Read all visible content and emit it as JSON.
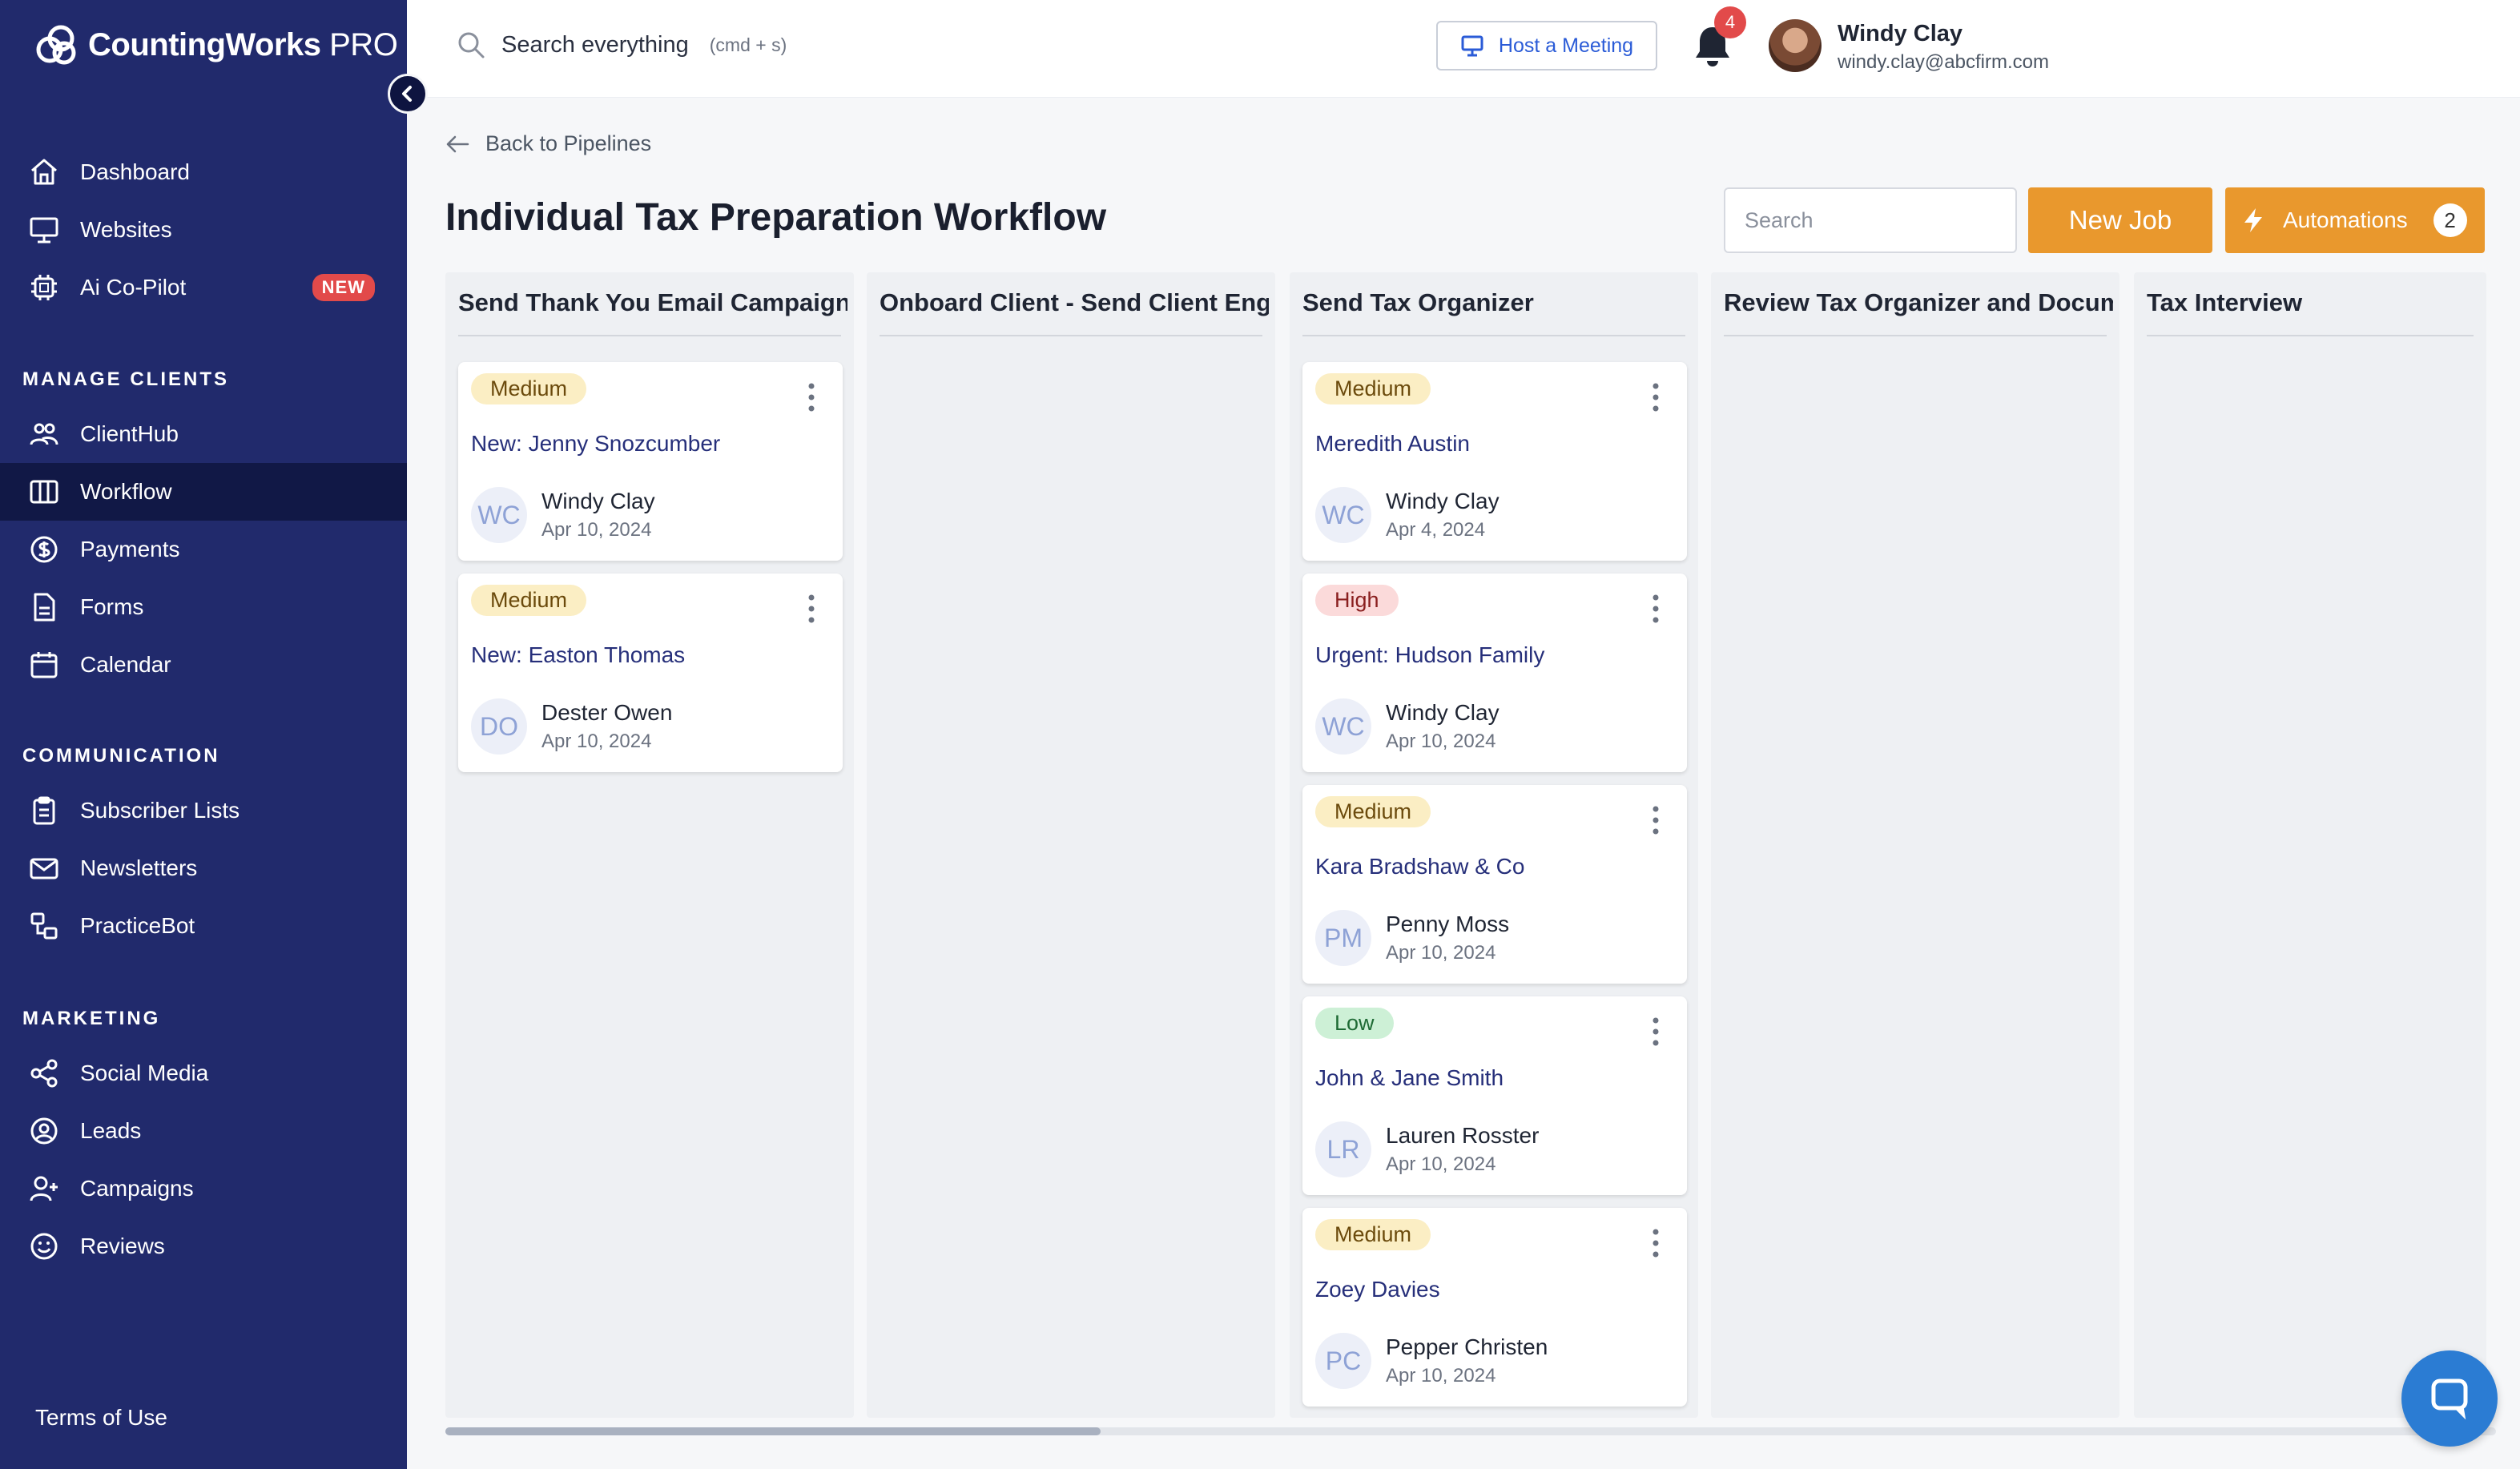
{
  "app": {
    "logo_main": "CountingWorks",
    "logo_pro": " PRO"
  },
  "sidebar": {
    "items_top": [
      {
        "label": "Dashboard",
        "icon": "home-icon"
      },
      {
        "label": "Websites",
        "icon": "monitor-icon"
      },
      {
        "label": "Ai Co-Pilot",
        "icon": "chip-icon",
        "badge": "NEW"
      }
    ],
    "section_manage": "MANAGE CLIENTS",
    "items_manage": [
      {
        "label": "ClientHub",
        "icon": "users-icon"
      },
      {
        "label": "Workflow",
        "icon": "columns-icon",
        "active": true
      },
      {
        "label": "Payments",
        "icon": "dollar-icon"
      },
      {
        "label": "Forms",
        "icon": "document-icon"
      },
      {
        "label": "Calendar",
        "icon": "calendar-icon"
      }
    ],
    "section_comm": "COMMUNICATION",
    "items_comm": [
      {
        "label": "Subscriber Lists",
        "icon": "clipboard-icon"
      },
      {
        "label": "Newsletters",
        "icon": "mail-icon"
      },
      {
        "label": "PracticeBot",
        "icon": "bot-icon"
      }
    ],
    "section_marketing": "MARKETING",
    "items_marketing": [
      {
        "label": "Social Media",
        "icon": "share-icon"
      },
      {
        "label": "Leads",
        "icon": "user-circle-icon"
      },
      {
        "label": "Campaigns",
        "icon": "user-plus-icon"
      },
      {
        "label": "Reviews",
        "icon": "smile-icon"
      }
    ],
    "terms": "Terms of Use"
  },
  "topbar": {
    "search_label": "Search everything",
    "search_hint": "(cmd + s)",
    "host_meeting": "Host a Meeting",
    "notification_count": "4",
    "user_name": "Windy Clay",
    "user_email": "windy.clay@abcfirm.com"
  },
  "main": {
    "back_label": "Back to Pipelines",
    "title": "Individual Tax Preparation Workflow",
    "search_placeholder": "Search",
    "new_job": "New Job",
    "automations": "Automations",
    "automations_count": "2"
  },
  "columns": [
    {
      "title": "Send Thank You Email Campaign",
      "cards": [
        {
          "priority": "Medium",
          "level": "medium",
          "client": "New: Jenny Snozcumber",
          "initials": "WC",
          "assignee": "Windy Clay",
          "date": "Apr 10, 2024"
        },
        {
          "priority": "Medium",
          "level": "medium",
          "client": "New: Easton Thomas",
          "initials": "DO",
          "assignee": "Dester Owen",
          "date": "Apr 10, 2024"
        }
      ]
    },
    {
      "title": "Onboard Client - Send Client Engagement",
      "cards": []
    },
    {
      "title": "Send Tax Organizer",
      "cards": [
        {
          "priority": "Medium",
          "level": "medium",
          "client": "Meredith Austin",
          "initials": "WC",
          "assignee": "Windy Clay",
          "date": "Apr 4, 2024"
        },
        {
          "priority": "High",
          "level": "high",
          "client": "Urgent: Hudson Family",
          "initials": "WC",
          "assignee": "Windy Clay",
          "date": "Apr 10, 2024"
        },
        {
          "priority": "Medium",
          "level": "medium",
          "client": "Kara Bradshaw & Co",
          "initials": "PM",
          "assignee": "Penny Moss",
          "date": "Apr 10, 2024"
        },
        {
          "priority": "Low",
          "level": "low",
          "client": "John & Jane Smith",
          "initials": "LR",
          "assignee": "Lauren Rosster",
          "date": "Apr 10, 2024"
        },
        {
          "priority": "Medium",
          "level": "medium",
          "client": "Zoey Davies",
          "initials": "PC",
          "assignee": "Pepper Christen",
          "date": "Apr 10, 2024"
        }
      ]
    },
    {
      "title": "Review Tax Organizer and Documents",
      "cards": []
    },
    {
      "title": "Tax Interview",
      "cards": []
    }
  ]
}
